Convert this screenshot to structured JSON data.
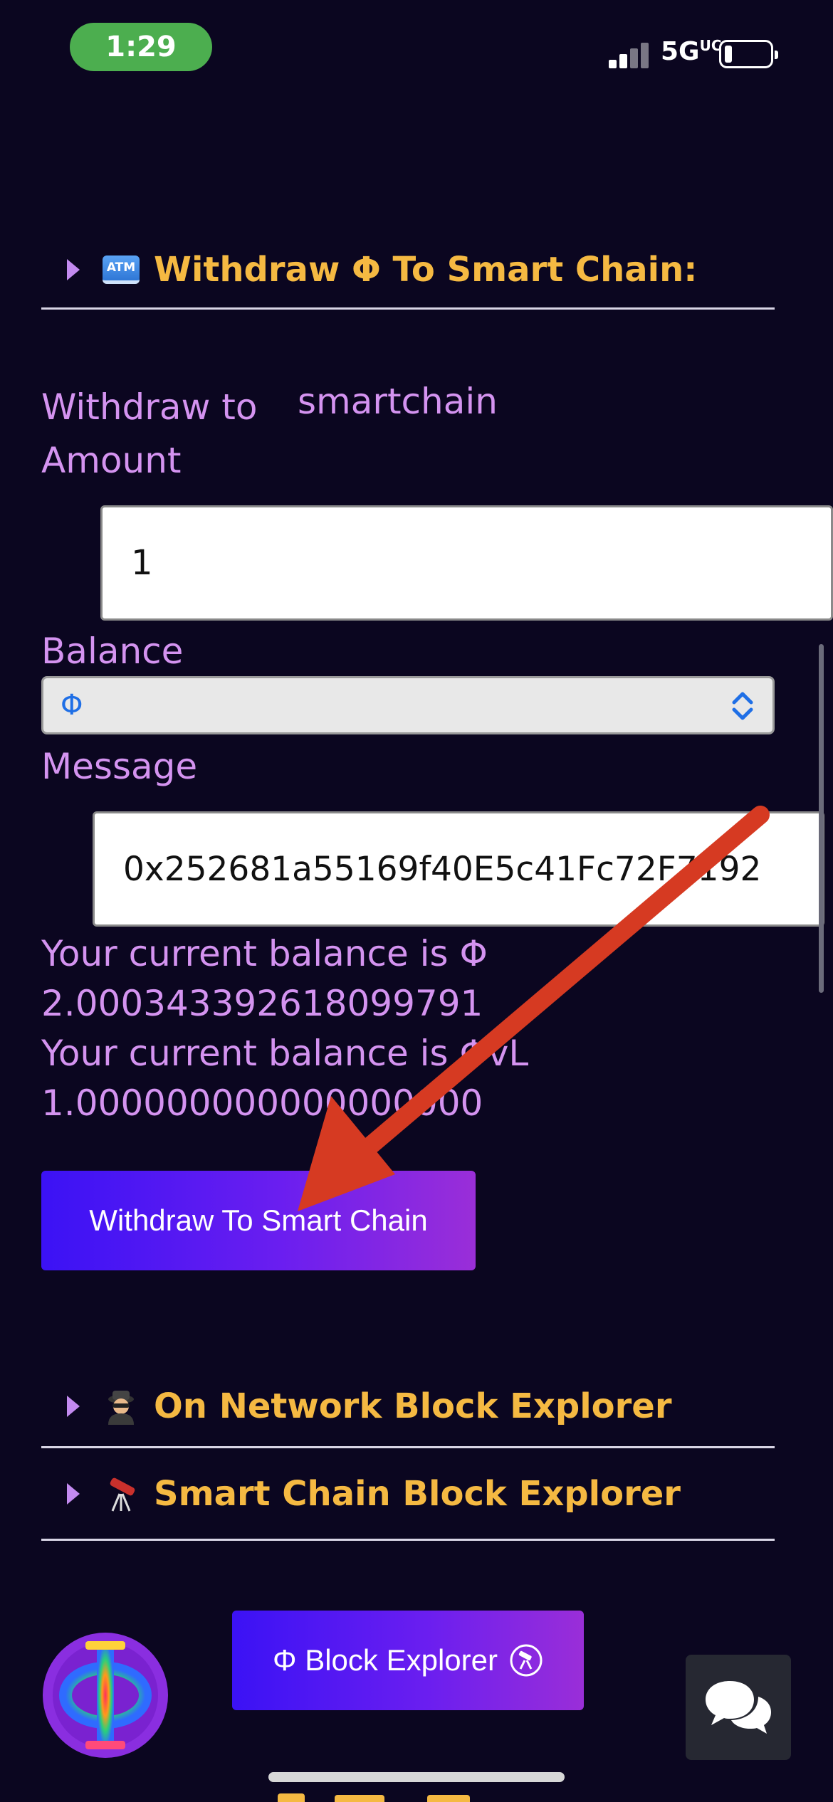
{
  "status_bar": {
    "time": "1:29",
    "network": "5G",
    "network_suffix": "UC"
  },
  "withdraw_section": {
    "icon": "atm-icon",
    "icon_text": "ATM",
    "title": "Withdraw Φ To Smart Chain:"
  },
  "form": {
    "withdraw_to_label": "Withdraw to",
    "withdraw_to_value": "smartchain",
    "amount_label": "Amount",
    "amount_value": "1",
    "balance_label": "Balance",
    "balance_select_value": "Φ",
    "message_label": "Message",
    "message_value": "0x252681a55169f40E5c41Fc72F7192"
  },
  "balances": {
    "line1_prefix": "Your current balance is Φ",
    "line1_value": "2.000343392618099791",
    "line2_prefix": "Your current balance is ΦvL",
    "line2_value": "1.000000000000000000"
  },
  "withdraw_button": {
    "label": "Withdraw To Smart Chain"
  },
  "sections": [
    {
      "icon": "spy-icon",
      "title": "On Network Block Explorer"
    },
    {
      "icon": "telescope-icon",
      "title": "Smart Chain Block Explorer"
    }
  ],
  "block_explorer_button": {
    "label": "Φ Block Explorer",
    "icon": "telescope-icon"
  },
  "chat_button": {
    "icon": "chat-bubbles-icon"
  },
  "colors": {
    "background": "#0b0620",
    "heading": "#f5b942",
    "label": "#d493f0",
    "button_start": "#3b12f5",
    "button_end": "#9a2ed8",
    "arrow": "#d63a22"
  }
}
